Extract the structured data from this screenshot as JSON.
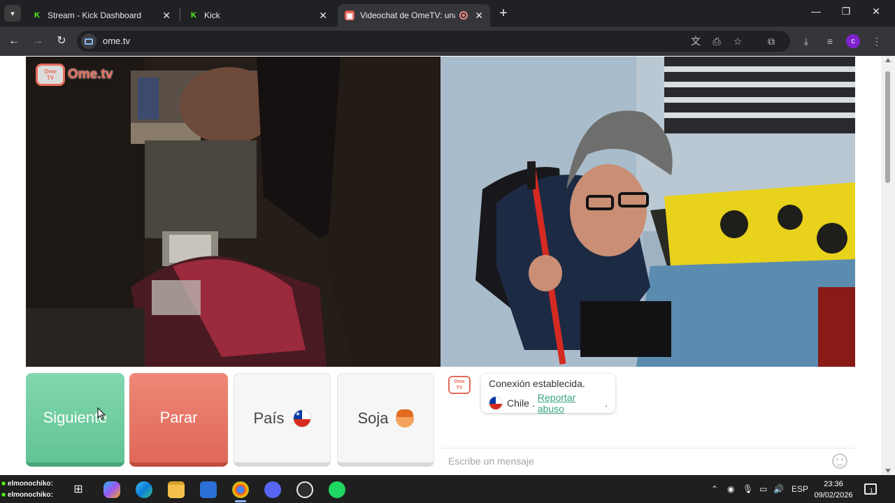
{
  "browser": {
    "tabs": [
      {
        "label": "Stream - Kick Dashboard",
        "favicon": "kick-icon",
        "active": false
      },
      {
        "label": "Kick",
        "favicon": "kick-icon",
        "active": false
      },
      {
        "label": "Videochat de OmeTV: una a",
        "favicon": "ometv-icon",
        "active": true,
        "recording": true
      }
    ],
    "address": "ome.tv"
  },
  "page": {
    "logo_tv_top": "Ome",
    "logo_tv_bottom": "TV",
    "logo_text": "Ome.tv",
    "buttons": {
      "next": "Siguiente",
      "stop": "Parar",
      "country": "País",
      "gender": "Soja"
    },
    "chat": {
      "status": "Conexión establecida.",
      "country": "Chile",
      "separator": ".",
      "report": "Reportar abuso",
      "report_suffix": ".",
      "input_placeholder": "Escribe un mensaje"
    }
  },
  "taskbar": {
    "overlay_name_1": "elmonochiko:",
    "overlay_name_2": "elmonochiko:",
    "language": "ESP",
    "time": "23:36",
    "date": "09/02/2026",
    "notification_count": "1"
  },
  "colors": {
    "next_button": "#6fcb9f",
    "stop_button": "#e7786a",
    "brand": "#e46c5b",
    "report_link": "#3aa57a"
  }
}
